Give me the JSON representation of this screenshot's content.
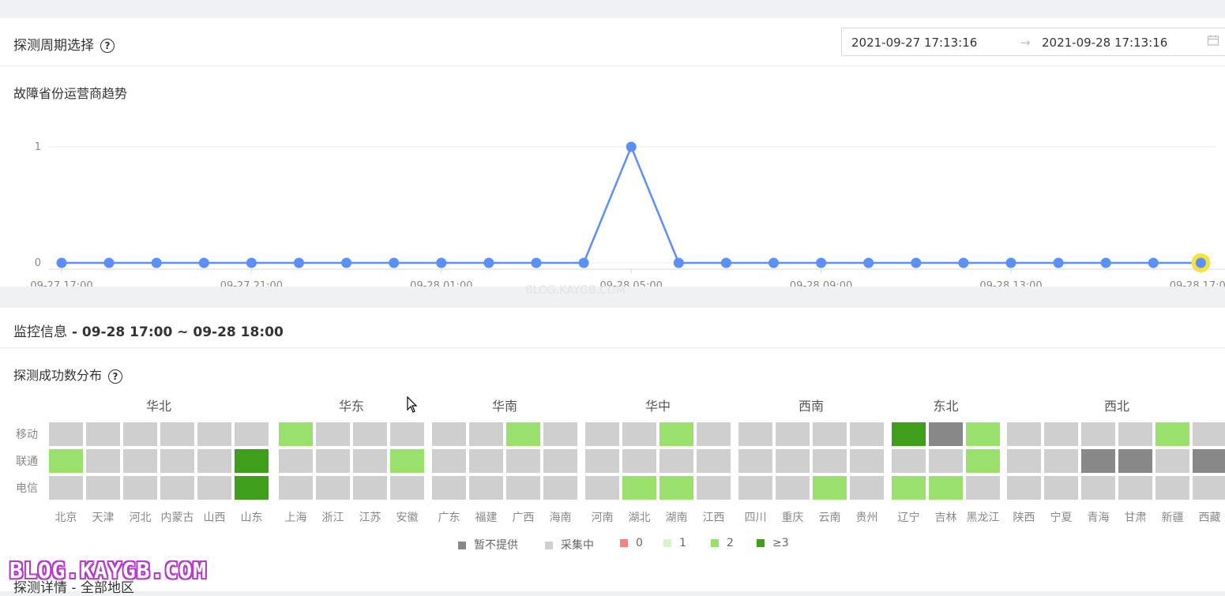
{
  "probe_period": {
    "title": "探测周期选择",
    "help": "?",
    "start": "2021-09-27 17:13:16",
    "arrow": "→",
    "end": "2021-09-28 17:13:16"
  },
  "trend": {
    "title": "故障省份运营商趋势"
  },
  "chart_data": {
    "type": "line",
    "title": "故障省份运营商趋势",
    "x": [
      "09-27 17:00",
      "09-27 18:00",
      "09-27 19:00",
      "09-27 20:00",
      "09-27 21:00",
      "09-27 22:00",
      "09-27 23:00",
      "09-28 00:00",
      "09-28 01:00",
      "09-28 02:00",
      "09-28 03:00",
      "09-28 04:00",
      "09-28 05:00",
      "09-28 06:00",
      "09-28 07:00",
      "09-28 08:00",
      "09-28 09:00",
      "09-28 10:00",
      "09-28 11:00",
      "09-28 12:00",
      "09-28 13:00",
      "09-28 14:00",
      "09-28 15:00",
      "09-28 16:00",
      "09-28 17:00"
    ],
    "values": [
      0,
      0,
      0,
      0,
      0,
      0,
      0,
      0,
      0,
      0,
      0,
      0,
      1,
      0,
      0,
      0,
      0,
      0,
      0,
      0,
      0,
      0,
      0,
      0,
      0
    ],
    "xticks": [
      "09-27 17:00",
      "09-27 21:00",
      "09-28 01:00",
      "09-28 05:00",
      "09-28 09:00",
      "09-28 13:00",
      "09-28 17:00"
    ],
    "yticks": [
      "0",
      "1"
    ],
    "ylim": [
      0,
      1
    ],
    "highlighted_point": "09-28 17:00",
    "grid": true,
    "colors": {
      "line": "#5b8ff9",
      "highlight": "#f7e13a"
    }
  },
  "monitor": {
    "title": "监控信息",
    "range": " - 09-28 17:00 ~ 09-28 18:00"
  },
  "distribution": {
    "title": "探测成功数分布",
    "help": "?",
    "row_labels": [
      "移动",
      "联通",
      "电信"
    ],
    "regions": [
      {
        "name": "华北",
        "provinces": [
          "北京",
          "天津",
          "河北",
          "内蒙古",
          "山西",
          "山东"
        ],
        "cells": [
          [
            "c",
            "c",
            "c",
            "c",
            "c",
            "c"
          ],
          [
            "2",
            "c",
            "c",
            "c",
            "c",
            "3"
          ],
          [
            "c",
            "c",
            "c",
            "c",
            "c",
            "3"
          ]
        ]
      },
      {
        "name": "华东",
        "provinces": [
          "上海",
          "浙江",
          "江苏",
          "安徽"
        ],
        "cells": [
          [
            "2",
            "c",
            "c",
            "c"
          ],
          [
            "c",
            "c",
            "c",
            "2"
          ],
          [
            "c",
            "c",
            "c",
            "c"
          ]
        ]
      },
      {
        "name": "华南",
        "provinces": [
          "广东",
          "福建",
          "广西",
          "海南"
        ],
        "cells": [
          [
            "c",
            "c",
            "2",
            "c"
          ],
          [
            "c",
            "c",
            "c",
            "c"
          ],
          [
            "c",
            "c",
            "c",
            "c"
          ]
        ]
      },
      {
        "name": "华中",
        "provinces": [
          "河南",
          "湖北",
          "湖南",
          "江西"
        ],
        "cells": [
          [
            "c",
            "c",
            "2",
            "c"
          ],
          [
            "c",
            "c",
            "c",
            "c"
          ],
          [
            "c",
            "2",
            "2",
            "c"
          ]
        ]
      },
      {
        "name": "西南",
        "provinces": [
          "四川",
          "重庆",
          "云南",
          "贵州"
        ],
        "cells": [
          [
            "c",
            "c",
            "c",
            "c"
          ],
          [
            "c",
            "c",
            "c",
            "c"
          ],
          [
            "c",
            "c",
            "2",
            "c"
          ]
        ]
      },
      {
        "name": "东北",
        "provinces": [
          "辽宁",
          "吉林",
          "黑龙江"
        ],
        "cells": [
          [
            "3",
            "n",
            "2"
          ],
          [
            "c",
            "c",
            "2"
          ],
          [
            "2",
            "2",
            "c"
          ]
        ]
      },
      {
        "name": "西北",
        "provinces": [
          "陕西",
          "宁夏",
          "青海",
          "甘肃",
          "新疆",
          "西藏"
        ],
        "cells": [
          [
            "c",
            "c",
            "c",
            "c",
            "2",
            "c"
          ],
          [
            "c",
            "c",
            "n",
            "n",
            "c",
            "n"
          ],
          [
            "c",
            "c",
            "c",
            "c",
            "c",
            "c"
          ]
        ]
      }
    ],
    "legend": [
      {
        "key": "n",
        "label": "暂不提供",
        "color": "#888888"
      },
      {
        "key": "c",
        "label": "采集中",
        "color": "#cfcfcf"
      },
      {
        "key": "0",
        "label": "0",
        "color": "#f4837f"
      },
      {
        "key": "1",
        "label": "1",
        "color": "#d6f5c7"
      },
      {
        "key": "2",
        "label": "2",
        "color": "#9ae06c"
      },
      {
        "key": "3",
        "label": "≥3",
        "color": "#3f9e1a"
      }
    ]
  },
  "details": {
    "title": "探测详情 - 全部地区"
  },
  "watermark": {
    "text": "BLOG.KAYGB.COM",
    "faint_text": "BLOG.KAYGB.COM"
  }
}
